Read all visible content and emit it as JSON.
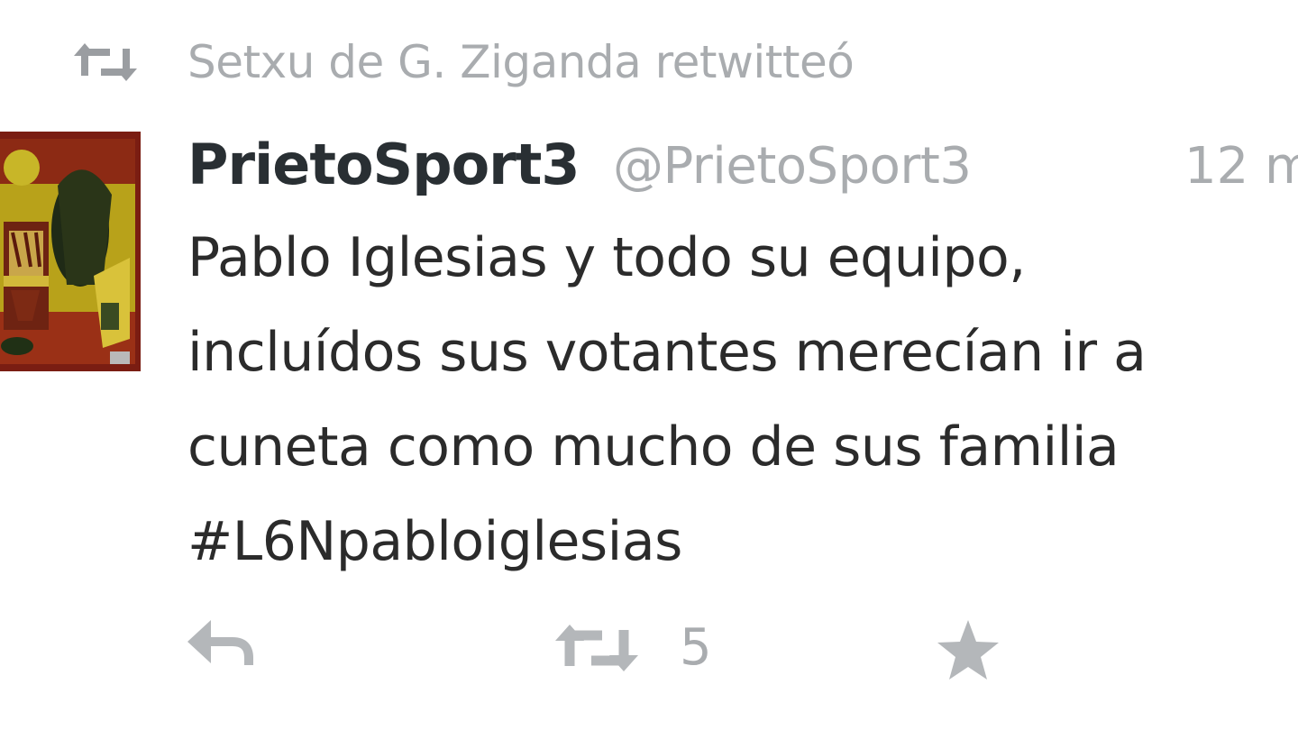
{
  "retweet_context": {
    "icon": "retweet-icon",
    "text": "Setxu de G. Ziganda retwitteó"
  },
  "tweet": {
    "avatar": "avatar-image",
    "display_name": "PrietoSport3",
    "handle": "@PrietoSport3",
    "timestamp": "12 m",
    "body_lines": [
      "Pablo Iglesias y todo su equipo,",
      "incluídos sus votantes merecían ir a",
      "cuneta como mucho de sus familia",
      "#L6Npabloiglesias"
    ]
  },
  "actions": {
    "reply_icon": "reply-icon",
    "retweet_icon": "retweet-icon",
    "retweet_count": "5",
    "favorite_icon": "star-icon"
  },
  "colors": {
    "text_primary": "#292f33",
    "text_secondary": "#a9acaf",
    "icon_gray": "#b4b7ba",
    "background": "#ffffff"
  }
}
